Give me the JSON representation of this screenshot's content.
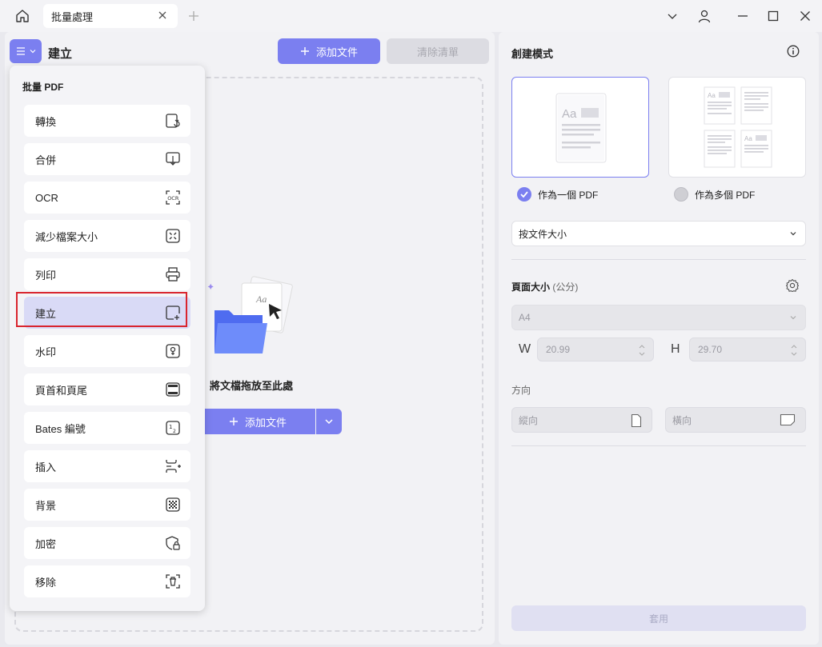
{
  "titlebar": {
    "tab_label": "批量處理"
  },
  "left": {
    "page_title": "建立",
    "add_file_label": "添加文件",
    "clear_list_label": "清除清單",
    "drop_text": "將文檔拖放至此處",
    "add_file_main_label": "添加文件"
  },
  "menu": {
    "header": "批量 PDF",
    "items": [
      {
        "label": "轉換",
        "icon": "convert-icon"
      },
      {
        "label": "合併",
        "icon": "merge-icon"
      },
      {
        "label": "OCR",
        "icon": "ocr-icon"
      },
      {
        "label": "減少檔案大小",
        "icon": "compress-icon"
      },
      {
        "label": "列印",
        "icon": "print-icon"
      },
      {
        "label": "建立",
        "icon": "create-icon"
      },
      {
        "label": "水印",
        "icon": "watermark-icon"
      },
      {
        "label": "頁首和頁尾",
        "icon": "header-footer-icon"
      },
      {
        "label": "Bates 編號",
        "icon": "bates-number-icon"
      },
      {
        "label": "插入",
        "icon": "insert-icon"
      },
      {
        "label": "背景",
        "icon": "background-icon"
      },
      {
        "label": "加密",
        "icon": "encrypt-icon"
      },
      {
        "label": "移除",
        "icon": "remove-icon"
      }
    ],
    "active_index": 5
  },
  "right": {
    "title": "創建模式",
    "mode_single_label": "作為一個 PDF",
    "mode_multi_label": "作為多個 PDF",
    "mode_selected": "single",
    "split_select_value": "按文件大小",
    "page_size_title": "頁面大小",
    "page_size_unit": "(公分)",
    "page_size_value": "A4",
    "width_label": "W",
    "width_value": "20.99",
    "height_label": "H",
    "height_value": "29.70",
    "orientation_title": "方向",
    "portrait_label": "縱向",
    "landscape_label": "橫向",
    "apply_label": "套用"
  },
  "colors": {
    "accent": "#7b7ff0",
    "highlight": "#d9252f"
  }
}
